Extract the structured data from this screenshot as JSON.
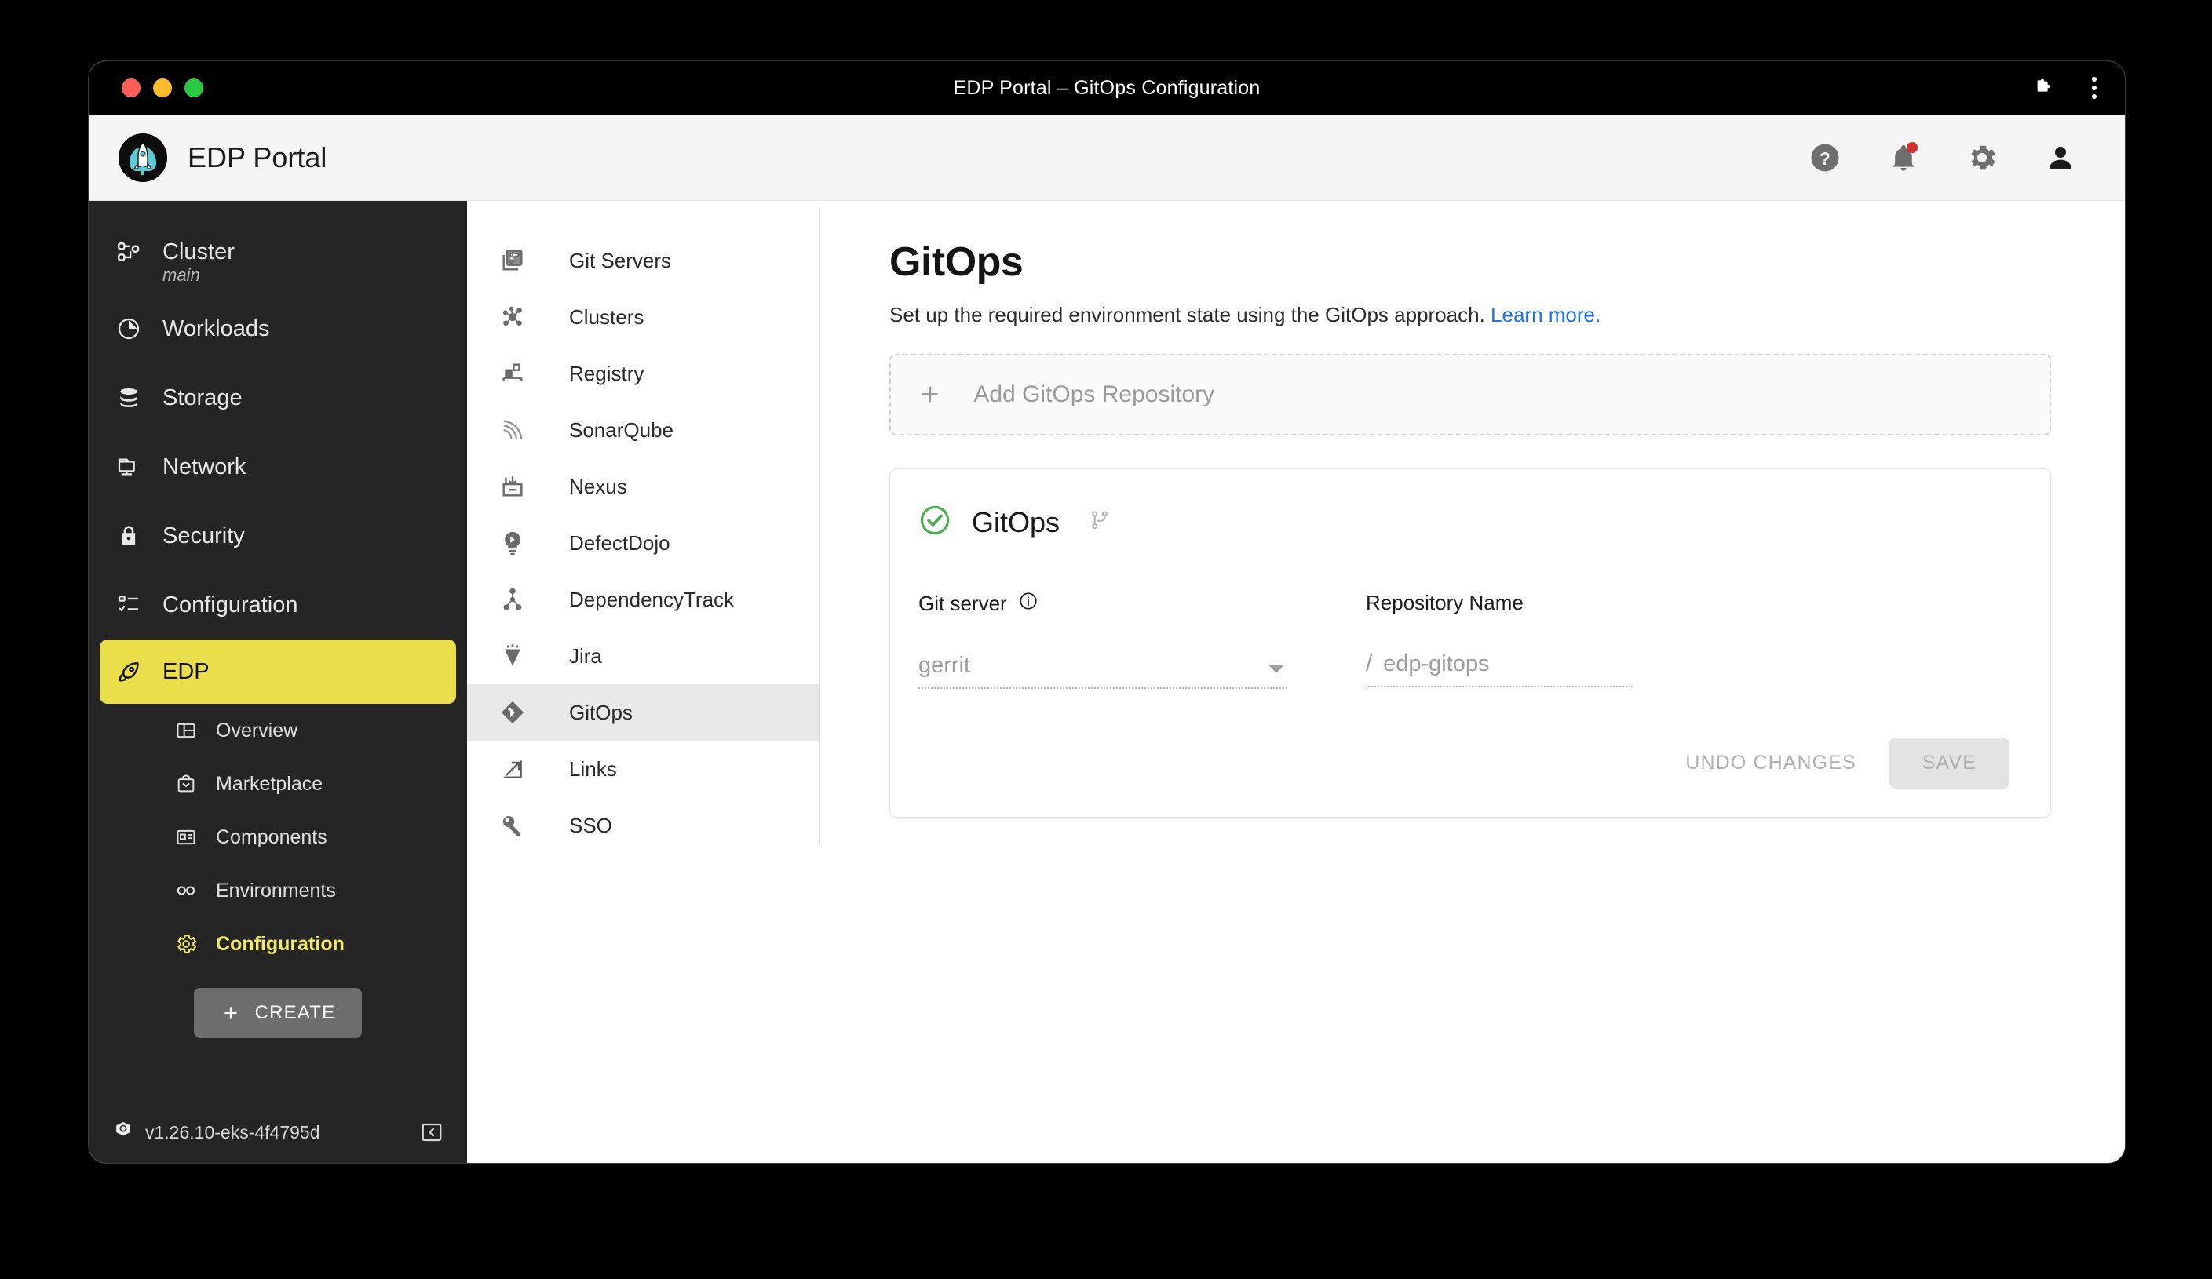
{
  "window": {
    "title": "EDP Portal – GitOps Configuration",
    "traffic_lights": [
      "close",
      "minimize",
      "zoom"
    ],
    "right_icons": [
      "extensions-puzzle-icon",
      "kebab-menu-icon"
    ]
  },
  "header": {
    "app_title": "EDP Portal",
    "logo": "rocket-logo",
    "actions": [
      {
        "name": "help-icon",
        "glyph": "?"
      },
      {
        "name": "notifications-bell-icon",
        "has_badge": true
      },
      {
        "name": "settings-gear-icon"
      },
      {
        "name": "user-account-icon"
      }
    ]
  },
  "sidebar": {
    "items": [
      {
        "label": "Cluster",
        "sub": "main",
        "icon": "cluster-icon"
      },
      {
        "label": "Workloads",
        "icon": "workloads-pie-icon"
      },
      {
        "label": "Storage",
        "icon": "storage-database-icon"
      },
      {
        "label": "Network",
        "icon": "network-monitor-icon"
      },
      {
        "label": "Security",
        "icon": "security-lock-icon"
      },
      {
        "label": "Configuration",
        "icon": "configuration-list-icon"
      }
    ],
    "active_item": {
      "label": "EDP",
      "icon": "rocket-icon"
    },
    "sub_items": [
      {
        "label": "Overview",
        "icon": "overview-layout-icon",
        "selected": false
      },
      {
        "label": "Marketplace",
        "icon": "marketplace-bag-icon",
        "selected": false
      },
      {
        "label": "Components",
        "icon": "components-card-icon",
        "selected": false
      },
      {
        "label": "Environments",
        "icon": "environments-infinity-icon",
        "selected": false
      },
      {
        "label": "Configuration",
        "icon": "configuration-gear-icon",
        "selected": true
      }
    ],
    "create_button": "CREATE",
    "version": "v1.26.10-eks-4f4795d",
    "version_icon": "kubernetes-icon",
    "collapse_icon": "collapse-left-icon"
  },
  "secondary_nav": {
    "items": [
      {
        "label": "Git Servers",
        "icon": "git-servers-icon",
        "active": false
      },
      {
        "label": "Clusters",
        "icon": "clusters-network-icon",
        "active": false
      },
      {
        "label": "Registry",
        "icon": "registry-icon",
        "active": false
      },
      {
        "label": "SonarQube",
        "icon": "sonarqube-icon",
        "active": false
      },
      {
        "label": "Nexus",
        "icon": "nexus-inbox-icon",
        "active": false
      },
      {
        "label": "DefectDojo",
        "icon": "defectdojo-bulb-icon",
        "active": false
      },
      {
        "label": "DependencyTrack",
        "icon": "dependencytrack-icon",
        "active": false
      },
      {
        "label": "Jira",
        "icon": "jira-icon",
        "active": false
      },
      {
        "label": "GitOps",
        "icon": "gitops-icon",
        "active": true
      },
      {
        "label": "Links",
        "icon": "links-external-icon",
        "active": false
      },
      {
        "label": "SSO",
        "icon": "sso-key-icon",
        "active": false
      }
    ]
  },
  "main": {
    "title": "GitOps",
    "subtitle": "Set up the required environment state using the GitOps approach.",
    "learn_more": "Learn more.",
    "add_repository": {
      "label": "Add GitOps Repository",
      "plus": "+"
    },
    "card": {
      "title": "GitOps",
      "status_icon": "check-circle-icon",
      "branch_icon": "git-branch-icon",
      "fields": {
        "git_server": {
          "label": "Git server",
          "info_icon": "info-circle-icon",
          "value": "gerrit",
          "dropdown_icon": "chevron-down-icon"
        },
        "repository_name": {
          "label": "Repository Name",
          "prefix": "/",
          "value": "edp-gitops"
        }
      },
      "undo_label": "UNDO CHANGES",
      "save_label": "SAVE"
    }
  },
  "colors": {
    "accent_yellow": "#eade4a",
    "selected_yellow": "#f2e96a",
    "link_blue": "#1a73e8",
    "status_green": "#4caf50",
    "sidebar_bg": "#252525",
    "badge_red": "#d32f2f"
  }
}
